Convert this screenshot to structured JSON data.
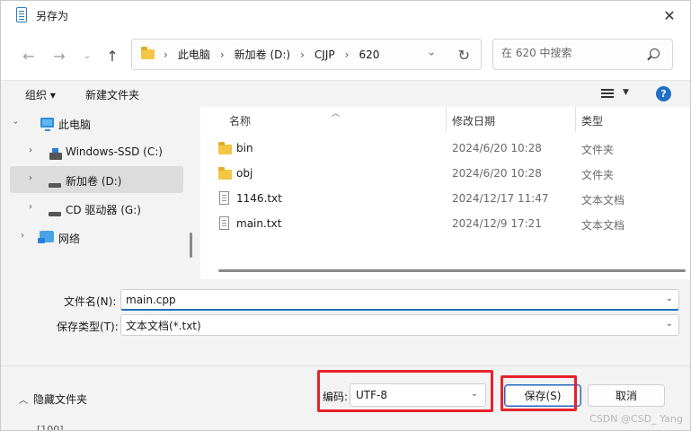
{
  "window": {
    "title": "另存为"
  },
  "nav": {
    "path": [
      "此电脑",
      "新加卷 (D:)",
      "CJJP",
      "620"
    ],
    "search_placeholder": "在 620 中搜索"
  },
  "toolbar": {
    "organize": "组织 ▾",
    "new_folder": "新建文件夹",
    "help": "?"
  },
  "sidebar": {
    "items": [
      {
        "label": "此电脑",
        "icon": "computer-icon"
      },
      {
        "label": "Windows-SSD (C:)",
        "icon": "windows-drive-icon"
      },
      {
        "label": "新加卷 (D:)",
        "icon": "drive-icon",
        "selected": true
      },
      {
        "label": "CD 驱动器 (G:)",
        "icon": "cd-drive-icon"
      },
      {
        "label": "网络",
        "icon": "network-icon"
      }
    ]
  },
  "files": {
    "columns": {
      "name": "名称",
      "date": "修改日期",
      "type": "类型"
    },
    "rows": [
      {
        "name": "bin",
        "date": "2024/6/20 10:28",
        "type": "文件夹",
        "icon": "folder-icon"
      },
      {
        "name": "obj",
        "date": "2024/6/20 10:28",
        "type": "文件夹",
        "icon": "folder-icon"
      },
      {
        "name": "1146.txt",
        "date": "2024/12/17 11:47",
        "type": "文本文档",
        "icon": "text-file-icon"
      },
      {
        "name": "main.txt",
        "date": "2024/12/9 17:21",
        "type": "文本文档",
        "icon": "text-file-icon"
      }
    ]
  },
  "form": {
    "filename_label": "文件名(N):",
    "filename_value": "main.cpp",
    "filetype_label": "保存类型(T):",
    "filetype_value": "文本文档(*.txt)"
  },
  "footer": {
    "hide_folders": "隐藏文件夹",
    "encoding_label": "编码:",
    "encoding_value": "UTF-8",
    "save": "保存(S)",
    "cancel": "取消"
  },
  "watermark": "CSDN @CSD_ Yang",
  "background_text": "[100]",
  "colors": {
    "accent": "#1f6fc6",
    "highlight_box": "#e8222a"
  }
}
